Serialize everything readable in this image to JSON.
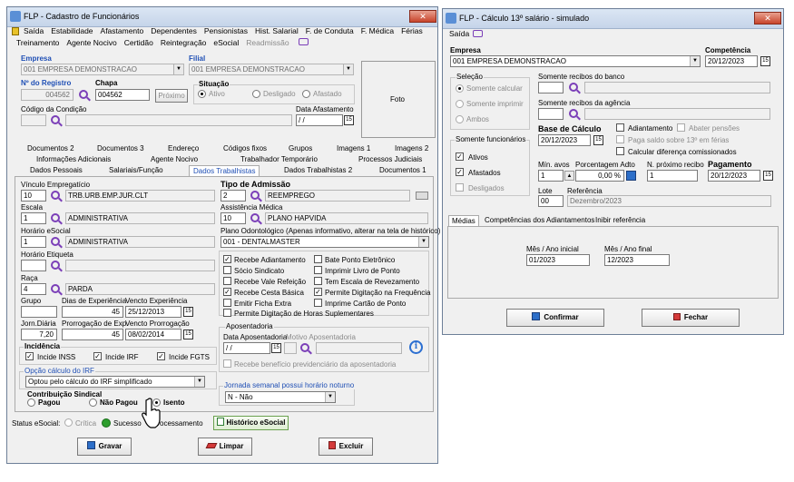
{
  "left": {
    "title": "FLP - Cadastro de Funcionários",
    "menu1": [
      "Saída",
      "Estabilidade",
      "Afastamento",
      "Dependentes",
      "Pensionistas",
      "Hist. Salarial",
      "F. de Conduta",
      "F. Médica",
      "Férias"
    ],
    "menu2": [
      "Treinamento",
      "Agente Nocivo",
      "Certidão",
      "Reintegração",
      "eSocial",
      "Readmissão"
    ],
    "empresa_label": "Empresa",
    "empresa_value": "001 EMPRESA DEMONSTRACAO",
    "filial_label": "Filial",
    "filial_value": "001 EMPRESA DEMONSTRACAO",
    "registro_label": "Nº do Registro",
    "registro_value": "004562",
    "chapa_label": "Chapa",
    "chapa_value": "004562",
    "proximo": "Próximo",
    "foto": "Foto",
    "situacao_label": "Situação",
    "sit_ativo": "Ativo",
    "sit_desligado": "Desligado",
    "sit_afastado": "Afastado",
    "cod_condicao_label": "Código da Condição",
    "data_afast_label": "Data Afastamento",
    "data_afast_value": "/ /",
    "tabs_row1": [
      "Documentos 2",
      "Documentos 3",
      "Endereço",
      "Códigos fixos",
      "Grupos",
      "Imagens 1",
      "Imagens 2"
    ],
    "tabs_row2": [
      "Informações Adicionais",
      "Agente Nocivo",
      "Trabalhador Temporário",
      "Processos Judiciais"
    ],
    "tabs_row3": [
      "Dados Pessoais",
      "Salariais/Função",
      "Dados Trabalhistas",
      "Dados Trabalhistas 2",
      "Documentos 1"
    ],
    "vinculo_label": "Vínculo Empregatício",
    "vinculo_code": "10",
    "vinculo_desc": "TRB.URB.EMP.JUR.CLT",
    "escala_label": "Escala",
    "escala_code": "1",
    "escala_desc": "ADMINISTRATIVA",
    "horario_label": "Horário eSocial",
    "horario_code": "1",
    "horario_desc": "ADMINISTRATIVA",
    "horario_etiq_label": "Horário Etiqueta",
    "raca_label": "Raça",
    "raca_code": "4",
    "raca_desc": "PARDA",
    "grupo_label": "Grupo",
    "dias_exp_label": "Dias de Experiência",
    "dias_exp_value": "45",
    "venc_exp_label": "Vencto Experiência",
    "venc_exp_value": "25/12/2013",
    "jorn_label": "Jorn.Diária",
    "jorn_value": "7,20",
    "prorrog_label": "Prorrogação de Exp.",
    "prorrog_value": "45",
    "venc_prorrog_label": "Vencto Prorrogação",
    "venc_prorrog_value": "08/02/2014",
    "incidencia_label": "Incidência",
    "inc_inss": "Incide INSS",
    "inc_irf": "Incide IRF",
    "inc_fgts": "Incide FGTS",
    "opcao_irf_label": "Opção cálculo do IRF",
    "opcao_irf_value": "Optou pelo cálculo do IRF simplificado",
    "contrib_label": "Contribuição Sindical",
    "c_pagou": "Pagou",
    "c_naopagou": "Não Pagou",
    "c_isento": "Isento",
    "tipo_adm_label": "Tipo de Admissão",
    "tipo_adm_code": "2",
    "tipo_adm_desc": "REEMPREGO",
    "assist_label": "Assistência Médica",
    "assist_code": "10",
    "assist_desc": "PLANO HAPVIDA",
    "plano_odonto_label": "Plano Odontológico (Apenas informativo, alterar na tela de histórico)",
    "plano_odonto_value": "001 - DENTALMASTER",
    "checks_left": [
      "Recebe Adiantamento",
      "Sócio Sindicato",
      "Recebe Vale Refeição",
      "Recebe Cesta Básica",
      "Emitir Ficha Extra",
      "Permite Digitação de Horas Suplementares"
    ],
    "checks_right": [
      "Bate Ponto Eletrônico",
      "Imprimir Livro de Ponto",
      "Tem Escala de Revezamento",
      "Permite Digitação na Frequência",
      "Imprime Cartão de Ponto"
    ],
    "aposent_label": "Aposentadoria",
    "data_apos_label": "Data Aposentadoria",
    "data_apos_value": "/ /",
    "motivo_apos_label": "Motivo Aposentadoria",
    "recebe_benef": "Recebe benefício previdenciário da aposentadoria",
    "jornada_label": "Jornada semanal possui horário noturno",
    "jornada_value": "N - Não",
    "status_esocial_label": "Status eSocial:",
    "st_critica": "Crítica",
    "st_sucesso": "Sucesso",
    "st_processamento": "Processamento",
    "hist_esocial": "Histórico eSocial",
    "btn_gravar": "Gravar",
    "btn_limpar": "Limpar",
    "btn_excluir": "Excluir"
  },
  "right": {
    "title": "FLP - Cálculo 13º salário - simulado",
    "menu_saida": "Saída",
    "empresa_label": "Empresa",
    "empresa_value": "001 EMPRESA DEMONSTRACAO",
    "competencia_label": "Competência",
    "competencia_value": "20/12/2023",
    "selecao_label": "Seleção",
    "sel1": "Somente calcular",
    "sel2": "Somente imprimir",
    "sel3": "Ambos",
    "rec_banco_label": "Somente recibos do banco",
    "rec_agencia_label": "Somente recibos da agência",
    "somente_func_label": "Somente funcionários",
    "f_ativos": "Ativos",
    "f_afastados": "Afastados",
    "f_desligados": "Desligados",
    "base_calc_label": "Base de Cálculo",
    "base_calc_value": "20/12/2023",
    "adiantamento": "Adiantamento",
    "abater_pensoes": "Abater pensões",
    "paga_saldo": "Paga saldo sobre 13º em férias",
    "calc_dif": "Calcular diferença comissionados",
    "min_avos_label": "Mín. avos",
    "min_avos_value": "1",
    "porc_label": "Porcentagem Adto",
    "porc_value": "0,00 %",
    "n_prox_label": "N. próximo recibo",
    "n_prox_value": "1",
    "pagamento_label": "Pagamento",
    "pagamento_value": "20/12/2023",
    "lote_label": "Lote",
    "lote_value": "00",
    "referencia_label": "Referência",
    "referencia_value": "Dezembro/2023",
    "tabs": [
      "Médias",
      "Competências dos Adiantamentos",
      "Inibir referência"
    ],
    "mes_ini_label": "Mês / Ano inicial",
    "mes_ini_value": "01/2023",
    "mes_fim_label": "Mês / Ano final",
    "mes_fim_value": "12/2023",
    "btn_confirmar": "Confirmar",
    "btn_fechar": "Fechar"
  }
}
